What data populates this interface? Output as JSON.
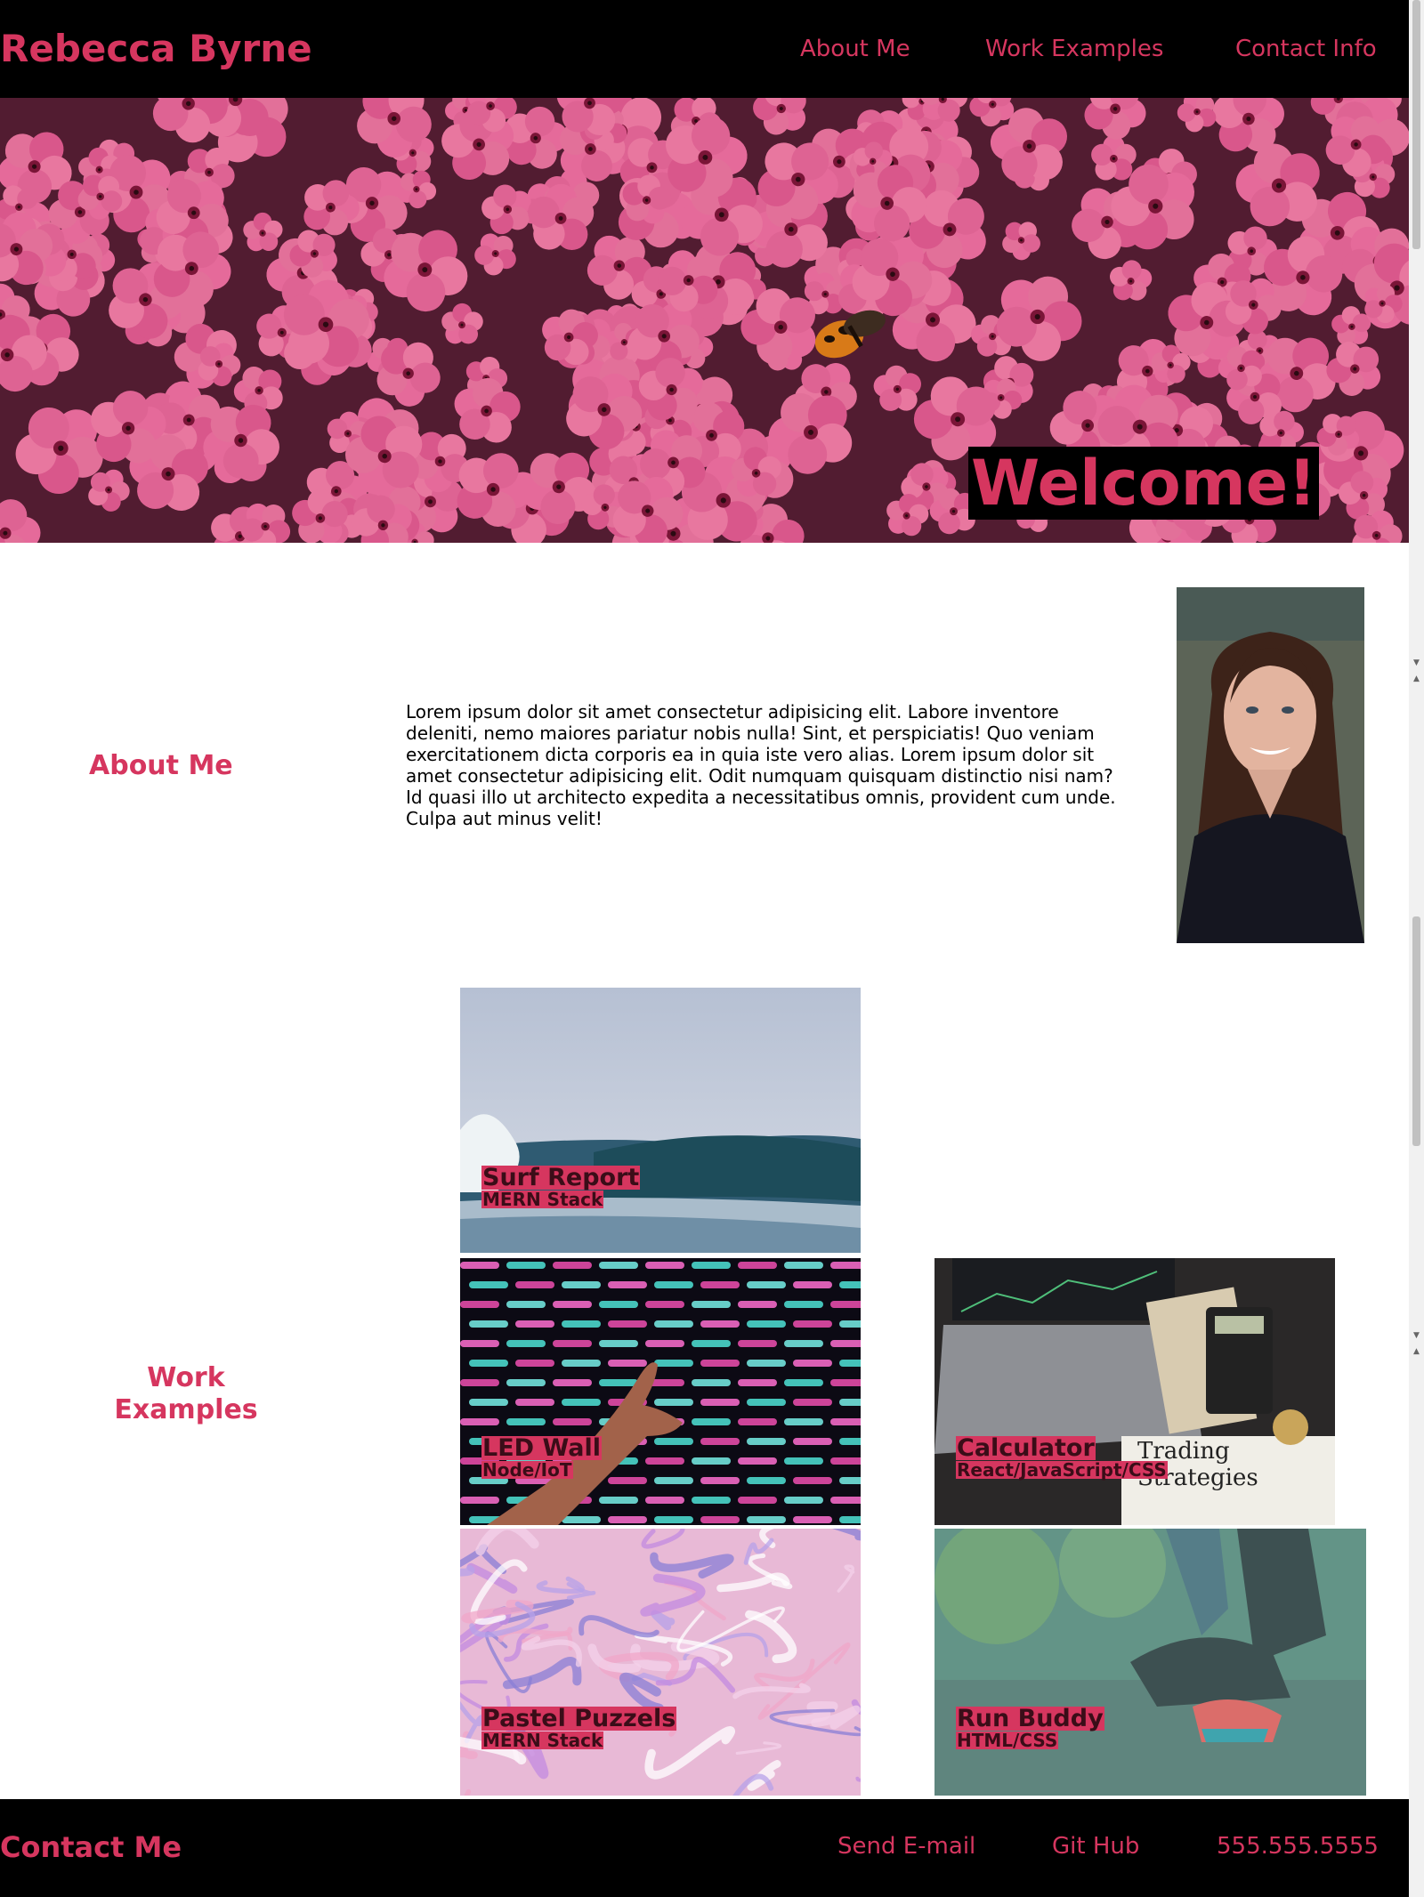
{
  "header": {
    "brand": "Rebecca Byrne",
    "nav": [
      "About Me",
      "Work Examples",
      "Contact Info"
    ]
  },
  "hero": {
    "welcome": "Welcome!",
    "image": "pink-flowers-butterfly-photo"
  },
  "about": {
    "heading": "About Me",
    "text": "Lorem ipsum dolor sit amet consectetur adipisicing elit. Labore inventore deleniti, nemo maiores pariatur nobis nulla! Sint, et perspiciatis! Quo veniam exercitationem dicta corporis ea in quia iste vero alias. Lorem ipsum dolor sit amet consectetur adipisicing elit. Odit numquam quisquam distinctio nisi nam? Id quasi illo ut architecto expedita a necessitatibus omnis, provident cum unde. Culpa aut minus velit!",
    "photo": "portrait-photo"
  },
  "work": {
    "heading": "Work Examples",
    "projects": [
      {
        "title": "Surf Report",
        "stack": "MERN Stack",
        "image": "ocean-wave"
      },
      {
        "title": "LED Wall",
        "stack": "Node/IoT",
        "image": "neon-led-lights"
      },
      {
        "title": "Calculator",
        "stack": "React/JavaScript/CSS",
        "image": "laptop-calculator",
        "photo_text": "Trading\nStrategies"
      },
      {
        "title": "Pastel Puzzels",
        "stack": "MERN Stack",
        "image": "pastel-marble"
      },
      {
        "title": "Run Buddy",
        "stack": "HTML/CSS",
        "image": "runner-tying-shoe"
      }
    ]
  },
  "footer": {
    "title": "Contact Me",
    "links": [
      "Send E-mail",
      "Git Hub",
      "555.555.5555"
    ]
  },
  "colors": {
    "accent": "#d6365f",
    "bar": "#000000",
    "background": "#ffffff"
  }
}
